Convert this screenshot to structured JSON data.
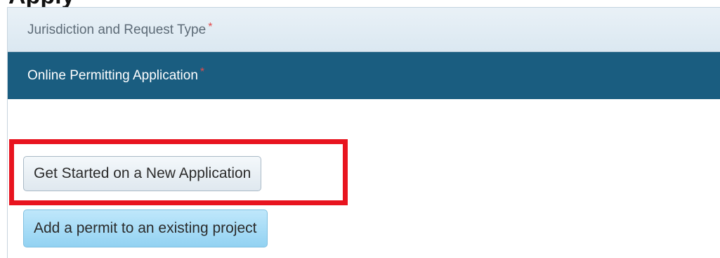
{
  "page": {
    "heading": "Apply"
  },
  "accordion": {
    "sections": [
      {
        "label": "Jurisdiction and Request Type",
        "required_marker": "*"
      },
      {
        "label": "Online Permitting Application",
        "required_marker": "*"
      }
    ]
  },
  "actions": {
    "new_application_label": "Get Started on a New Application",
    "existing_project_label": "Add a permit to an existing project"
  },
  "colors": {
    "active_section": "#1a5d80",
    "required_marker": "#e34b4b",
    "highlight_box": "#e8141f",
    "primary_button": "#92d2f2"
  }
}
